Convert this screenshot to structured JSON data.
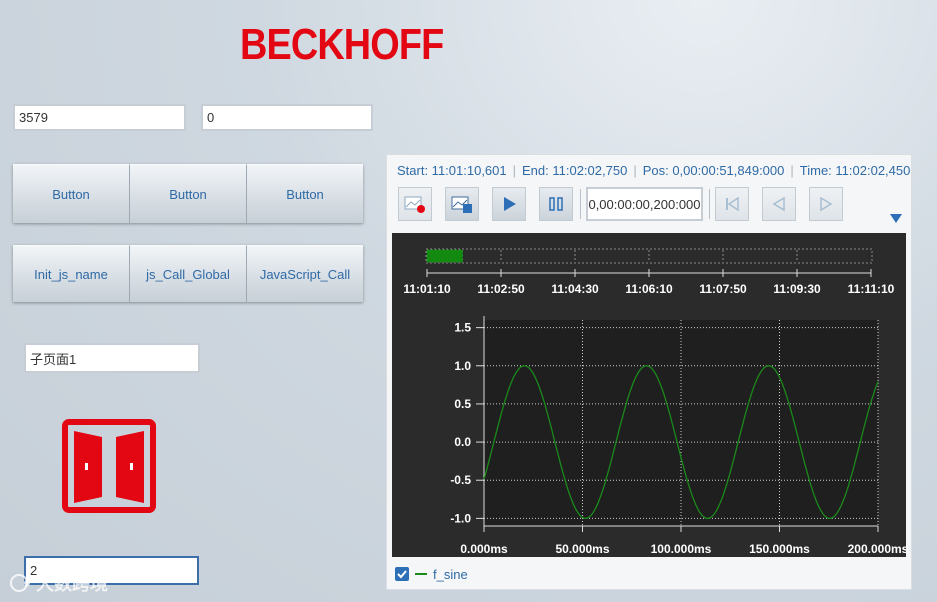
{
  "logo": {
    "text": "BECKHOFF",
    "color": "#e30613"
  },
  "inputs": {
    "value1": "3579",
    "value2": "0",
    "subpage": "子页面1",
    "active_input": "2"
  },
  "button_row1": [
    "Button",
    "Button",
    "Button"
  ],
  "button_row2": [
    "Init_js_name",
    "js_Call_Global",
    "JavaScript_Call"
  ],
  "door_icon": {
    "name": "door-open-icon",
    "color": "#e30613"
  },
  "trend": {
    "info": {
      "start": "Start: 11:01:10,601",
      "end": "End: 11:02:02,750",
      "pos": "Pos: 0,00:00:51,849:000",
      "time": "Time: 11:02:02,450"
    },
    "toolbar": {
      "icons": [
        "record-icon",
        "save-icon",
        "play-icon",
        "pause-icon",
        "skip-start-icon",
        "step-back-icon",
        "step-forward-icon",
        "dropdown-arrow-icon"
      ],
      "interval": "0,00:00:00,200:000"
    },
    "overview": {
      "tick_labels": [
        "11:01:10",
        "11:02:50",
        "11:04:30",
        "11:06:10",
        "11:07:50",
        "11:09:30",
        "11:11:10"
      ],
      "range_fraction": 0.08
    },
    "legend": {
      "checked": true,
      "series": "f_sine",
      "color": "#1a8a1a"
    }
  },
  "watermark": "大数跨境",
  "chart_data": {
    "type": "line",
    "x_tick_labels": [
      "0.000ms",
      "50.000ms",
      "100.000ms",
      "150.000ms",
      "200.000ms"
    ],
    "y_tick_labels": [
      "1.5",
      "1.0",
      "0.5",
      "0.0",
      "-0.5",
      "-1.0"
    ],
    "xlim": [
      0,
      200
    ],
    "ylim": [
      -1.1,
      1.6
    ],
    "grid": true,
    "series": [
      {
        "name": "f_sine",
        "function": "sin",
        "amplitude": 1.0,
        "period": 62,
        "phase_offset": 5,
        "color": "#1a8a1a"
      }
    ]
  }
}
